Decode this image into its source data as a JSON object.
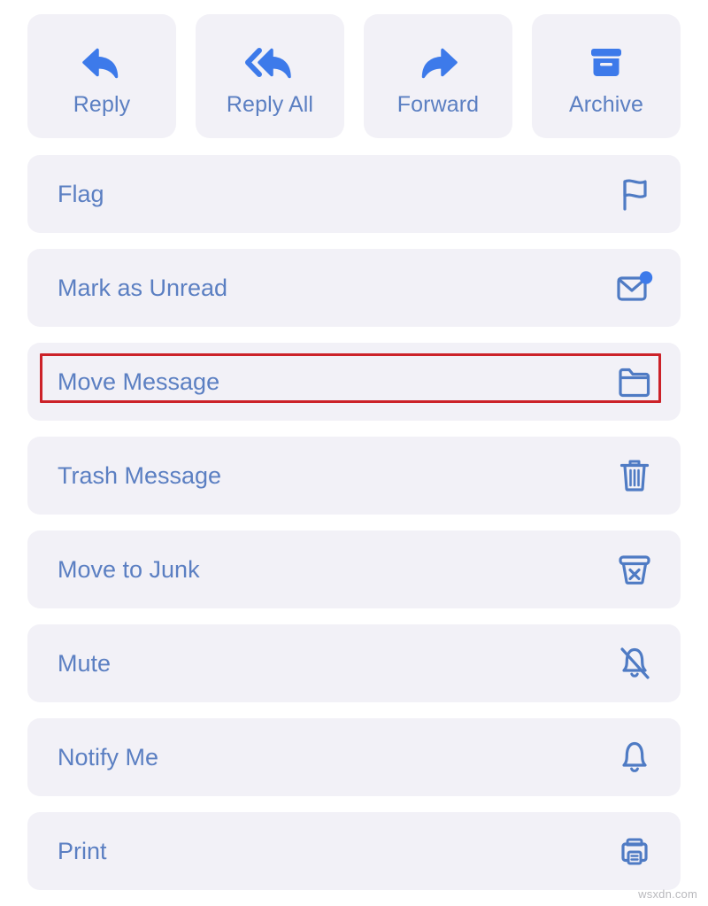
{
  "colors": {
    "page_background": "#ffffff",
    "card_background": "#f2f1f7",
    "label_blue": "#5b7fc2",
    "icon_blue_filled": "#3d7aea",
    "icon_blue_outline": "#4f7bc4",
    "highlight_red": "#cc2229"
  },
  "quick_actions": [
    {
      "label": "Reply",
      "icon": "reply-arrow-icon"
    },
    {
      "label": "Reply All",
      "icon": "reply-all-arrow-icon"
    },
    {
      "label": "Forward",
      "icon": "forward-arrow-icon"
    },
    {
      "label": "Archive",
      "icon": "archive-box-icon"
    }
  ],
  "menu_items": [
    {
      "label": "Flag",
      "icon": "flag-icon",
      "highlighted": false
    },
    {
      "label": "Mark as Unread",
      "icon": "envelope-badge-icon",
      "highlighted": false
    },
    {
      "label": "Move Message",
      "icon": "folder-icon",
      "highlighted": true
    },
    {
      "label": "Trash Message",
      "icon": "trash-can-icon",
      "highlighted": false
    },
    {
      "label": "Move to Junk",
      "icon": "junk-bin-x-icon",
      "highlighted": false
    },
    {
      "label": "Mute",
      "icon": "bell-slash-icon",
      "highlighted": false
    },
    {
      "label": "Notify Me",
      "icon": "bell-icon",
      "highlighted": false
    },
    {
      "label": "Print",
      "icon": "printer-icon",
      "highlighted": false
    }
  ],
  "watermark": {
    "text": "wsxdn.com"
  }
}
